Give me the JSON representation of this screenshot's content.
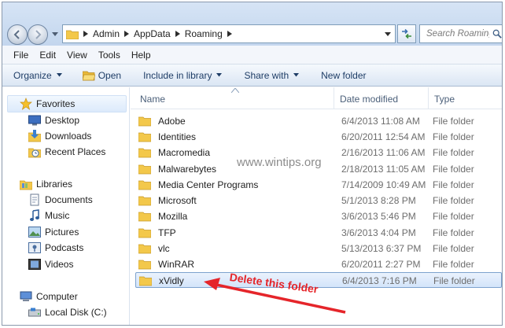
{
  "address": {
    "breadcrumbs": [
      "Admin",
      "AppData",
      "Roaming"
    ]
  },
  "search": {
    "placeholder": "Search Roaming"
  },
  "menu": [
    "File",
    "Edit",
    "View",
    "Tools",
    "Help"
  ],
  "toolbar": {
    "organize": "Organize",
    "open": "Open",
    "include_in_library": "Include in library",
    "share_with": "Share with",
    "new_folder": "New folder"
  },
  "nav": {
    "favorites": {
      "label": "Favorites",
      "items": [
        "Desktop",
        "Downloads",
        "Recent Places"
      ]
    },
    "libraries": {
      "label": "Libraries",
      "items": [
        "Documents",
        "Music",
        "Pictures",
        "Podcasts",
        "Videos"
      ]
    },
    "computer": {
      "label": "Computer",
      "items": [
        "Local Disk (C:)"
      ]
    }
  },
  "columns": {
    "name": "Name",
    "date_modified": "Date modified",
    "type": "Type"
  },
  "files": [
    {
      "name": "Adobe",
      "date": "6/4/2013 11:08 AM",
      "type": "File folder"
    },
    {
      "name": "Identities",
      "date": "6/20/2011 12:54 AM",
      "type": "File folder"
    },
    {
      "name": "Macromedia",
      "date": "2/16/2013 11:06 AM",
      "type": "File folder"
    },
    {
      "name": "Malwarebytes",
      "date": "2/18/2013 11:05 AM",
      "type": "File folder"
    },
    {
      "name": "Media Center Programs",
      "date": "7/14/2009 10:49 AM",
      "type": "File folder"
    },
    {
      "name": "Microsoft",
      "date": "5/1/2013 8:28 PM",
      "type": "File folder"
    },
    {
      "name": "Mozilla",
      "date": "3/6/2013 5:46 PM",
      "type": "File folder"
    },
    {
      "name": "TFP",
      "date": "3/6/2013 4:04 PM",
      "type": "File folder"
    },
    {
      "name": "vlc",
      "date": "5/13/2013 6:37 PM",
      "type": "File folder"
    },
    {
      "name": "WinRAR",
      "date": "6/20/2011 2:27 PM",
      "type": "File folder"
    },
    {
      "name": "xVidly",
      "date": "6/4/2013 7:16 PM",
      "type": "File folder"
    }
  ],
  "watermark": "www.wintips.org",
  "annotation": "Delete this folder",
  "colors": {
    "annotation": "#e5252a",
    "selection": "#d3e4fa",
    "folder": "#f3c84b"
  }
}
